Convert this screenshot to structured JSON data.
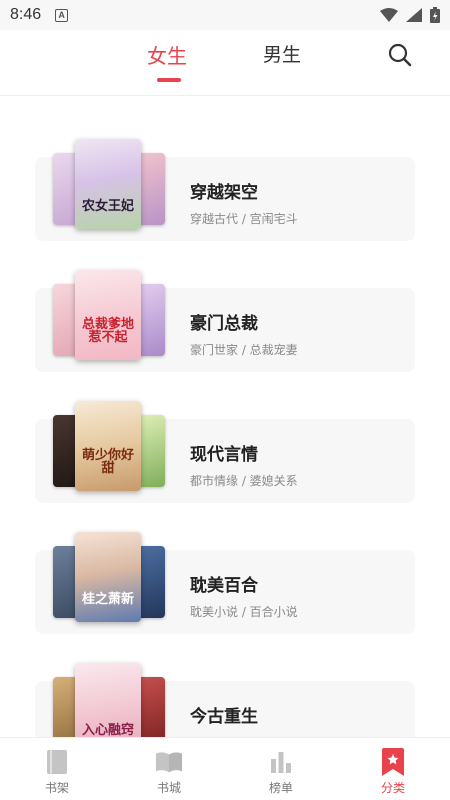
{
  "status_bar": {
    "time": "8:46",
    "notification_icon_letter": "A"
  },
  "header": {
    "tabs": [
      {
        "label": "女生",
        "active": true
      },
      {
        "label": "男生",
        "active": false
      }
    ],
    "accent_color": "#e8424c"
  },
  "categories": [
    {
      "name": "穿越架空",
      "subtitle": "穿越古代 / 宫闱宅斗",
      "cover_title": "农女王妃",
      "cover_colors": [
        "#d9c7ea",
        "#e9b7c5",
        "#c7a3d6"
      ]
    },
    {
      "name": "豪门总裁",
      "subtitle": "豪门世家 / 总裁宠妻",
      "cover_title": "总裁爹地惹不起",
      "cover_colors": [
        "#f3c6cf",
        "#f7d9de",
        "#d7b8e6"
      ]
    },
    {
      "name": "现代言情",
      "subtitle": "都市情缘 / 婆媳关系",
      "cover_title": "萌少你好甜",
      "cover_colors": [
        "#3a2a24",
        "#f0dcc0",
        "#cfe3a9"
      ]
    },
    {
      "name": "耽美百合",
      "subtitle": "耽美小说 / 百合小说",
      "cover_title": "桂之萧新",
      "cover_colors": [
        "#5b6d88",
        "#e8c8b9",
        "#3f5f8f"
      ]
    },
    {
      "name": "今古重生",
      "subtitle": "",
      "cover_title": "入心融窍",
      "cover_colors": [
        "#c7a06e",
        "#f1d2da",
        "#a83c3c"
      ]
    }
  ],
  "bottom_nav": [
    {
      "label": "书架",
      "icon": "bookshelf-icon",
      "active": false
    },
    {
      "label": "书城",
      "icon": "book-store-icon",
      "active": false
    },
    {
      "label": "榜单",
      "icon": "ranking-icon",
      "active": false
    },
    {
      "label": "分类",
      "icon": "category-icon",
      "active": true
    }
  ]
}
